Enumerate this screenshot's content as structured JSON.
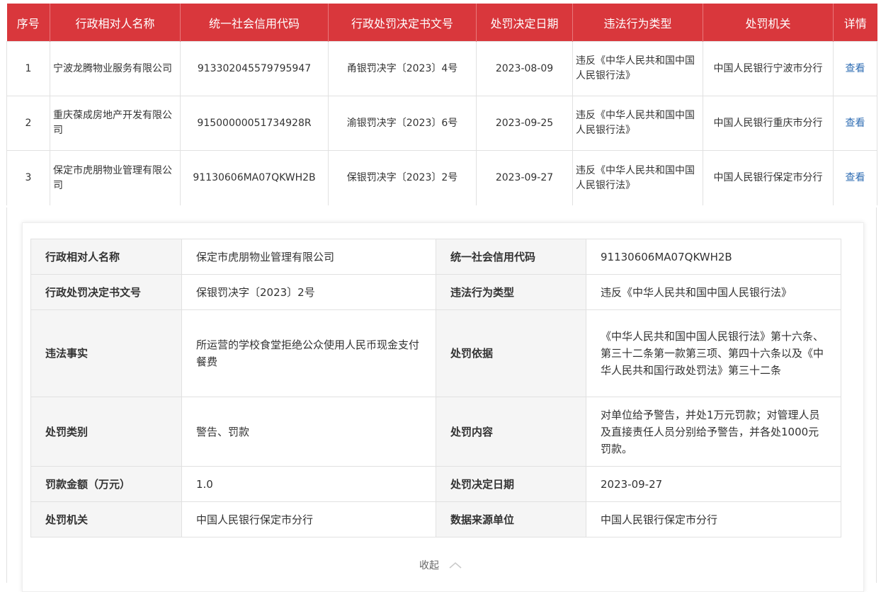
{
  "table": {
    "headers": [
      "序号",
      "行政相对人名称",
      "统一社会信用代码",
      "行政处罚决定书文号",
      "处罚决定日期",
      "违法行为类型",
      "处罚机关",
      "详情"
    ],
    "rows": [
      {
        "index": "1",
        "name": "宁波龙腾物业服务有限公司",
        "credit_code": "913302045579795947",
        "doc_no": "甬银罚决字〔2023〕4号",
        "date": "2023-08-09",
        "violation": "违反《中华人民共和国中国人民银行法》",
        "authority": "中国人民银行宁波市分行",
        "action": "查看"
      },
      {
        "index": "2",
        "name": "重庆葆成房地产开发有限公司",
        "credit_code": "91500000051734928R",
        "doc_no": "渝银罚决字〔2023〕6号",
        "date": "2023-09-25",
        "violation": "违反《中华人民共和国中国人民银行法》",
        "authority": "中国人民银行重庆市分行",
        "action": "查看"
      },
      {
        "index": "3",
        "name": "保定市虎朋物业管理有限公司",
        "credit_code": "91130606MA07QKWH2B",
        "doc_no": "保银罚决字〔2023〕2号",
        "date": "2023-09-27",
        "violation": "违反《中华人民共和国中国人民银行法》",
        "authority": "中国人民银行保定市分行",
        "action": "查看"
      }
    ]
  },
  "detail": {
    "rows": [
      [
        {
          "label": "行政相对人名称",
          "value": "保定市虎朋物业管理有限公司"
        },
        {
          "label": "统一社会信用代码",
          "value": "91130606MA07QKWH2B"
        }
      ],
      [
        {
          "label": "行政处罚决定书文号",
          "value": "保银罚决字〔2023〕2号"
        },
        {
          "label": "违法行为类型",
          "value": "违反《中华人民共和国中国人民银行法》"
        }
      ],
      [
        {
          "label": "违法事实",
          "value": "所运营的学校食堂拒绝公众使用人民币现金支付餐费"
        },
        {
          "label": "处罚依据",
          "value": "《中华人民共和国中国人民银行法》第十六条、第三十二条第一款第三项、第四十六条以及《中华人民共和国行政处罚法》第三十二条"
        }
      ],
      [
        {
          "label": "处罚类别",
          "value": "警告、罚款"
        },
        {
          "label": "处罚内容",
          "value": "对单位给予警告，并处1万元罚款；对管理人员及直接责任人员分别给予警告，并各处1000元罚款。"
        }
      ],
      [
        {
          "label": "罚款金额（万元）",
          "value": "1.0"
        },
        {
          "label": "处罚决定日期",
          "value": "2023-09-27"
        }
      ],
      [
        {
          "label": "处罚机关",
          "value": "中国人民银行保定市分行"
        },
        {
          "label": "数据来源单位",
          "value": "中国人民银行保定市分行"
        }
      ]
    ],
    "collapse_label": "收起",
    "collapse_icon": "chevron-up-icon"
  },
  "colors": {
    "header_bg": "#d9373c",
    "link": "#2f6db3"
  }
}
